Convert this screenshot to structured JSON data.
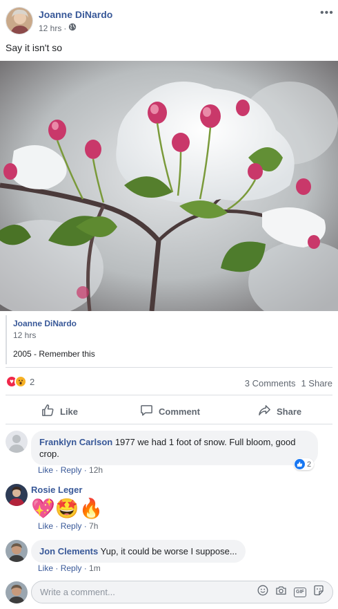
{
  "post": {
    "author": "Joanne DiNardo",
    "time": "12 hrs",
    "separator": "·",
    "text": "Say it isn't so",
    "more_label": "•••"
  },
  "shared": {
    "author": "Joanne DiNardo",
    "time": "12 hrs",
    "text": "2005 - Remember this"
  },
  "reactions": {
    "count": "2",
    "comments": "3 Comments",
    "shares": "1 Share"
  },
  "actions": {
    "like": "Like",
    "comment": "Comment",
    "share": "Share"
  },
  "comments": [
    {
      "name": "Franklyn Carlson",
      "text": "1977 we had 1 foot of snow. Full bloom, good crop.",
      "like": "Like",
      "reply": "Reply",
      "time": "12h",
      "reaction_count": "2"
    },
    {
      "name": "Rosie Leger",
      "emojis": "💖🤩🔥",
      "like": "Like",
      "reply": "Reply",
      "time": "7h"
    },
    {
      "name": "Jon Clements",
      "text": "Yup, it could be worse I suppose...",
      "like": "Like",
      "reply": "Reply",
      "time": "1m"
    }
  ],
  "composer": {
    "placeholder": "Write a comment...",
    "gif_label": "GIF"
  },
  "colors": {
    "link": "#385898",
    "muted": "#606770",
    "love": "#f0284a",
    "wow": "#f7b125",
    "like": "#1877f2"
  },
  "icons": [
    "globe-icon",
    "like-icon",
    "comment-icon",
    "share-icon",
    "emoji-icon",
    "camera-icon",
    "gif-icon",
    "sticker-icon"
  ]
}
